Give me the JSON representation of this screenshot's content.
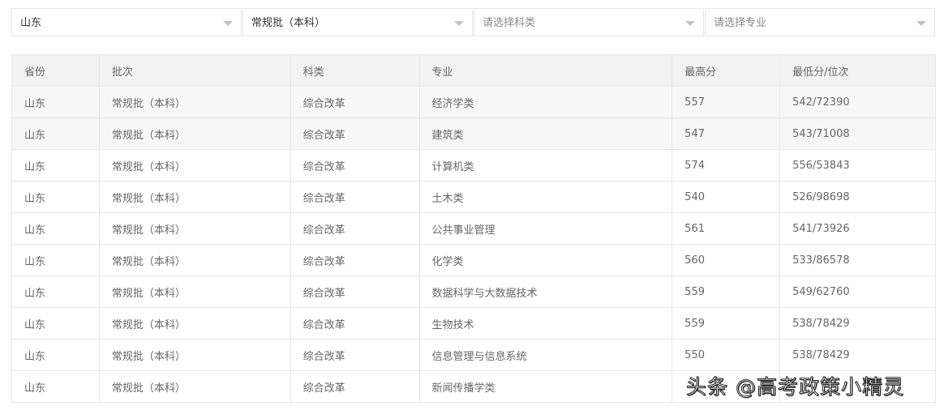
{
  "filters": [
    {
      "value": "山东",
      "placeholder": false
    },
    {
      "value": "常规批（本科）",
      "placeholder": false
    },
    {
      "value": "请选择科类",
      "placeholder": true
    },
    {
      "value": "请选择专业",
      "placeholder": true
    }
  ],
  "table": {
    "headers": [
      "省份",
      "批次",
      "科类",
      "专业",
      "最高分",
      "最低分/位次"
    ],
    "rows": [
      [
        "山东",
        "常规批（本科）",
        "综合改革",
        "经济学类",
        "557",
        "542/72390"
      ],
      [
        "山东",
        "常规批（本科）",
        "综合改革",
        "建筑类",
        "547",
        "543/71008"
      ],
      [
        "山东",
        "常规批（本科）",
        "综合改革",
        "计算机类",
        "574",
        "556/53843"
      ],
      [
        "山东",
        "常规批（本科）",
        "综合改革",
        "土木类",
        "540",
        "526/98698"
      ],
      [
        "山东",
        "常规批（本科）",
        "综合改革",
        "公共事业管理",
        "561",
        "541/73926"
      ],
      [
        "山东",
        "常规批（本科）",
        "综合改革",
        "化学类",
        "560",
        "533/86578"
      ],
      [
        "山东",
        "常规批（本科）",
        "综合改革",
        "数据科学与大数据技术",
        "559",
        "549/62760"
      ],
      [
        "山东",
        "常规批（本科）",
        "综合改革",
        "生物技术",
        "559",
        "538/78429"
      ],
      [
        "山东",
        "常规批（本科）",
        "综合改革",
        "信息管理与信息系统",
        "550",
        "538/78429"
      ],
      [
        "山东",
        "常规批（本科）",
        "综合改革",
        "新闻传播学类",
        "",
        ""
      ]
    ]
  },
  "watermark": "头条 @高考政策小精灵"
}
